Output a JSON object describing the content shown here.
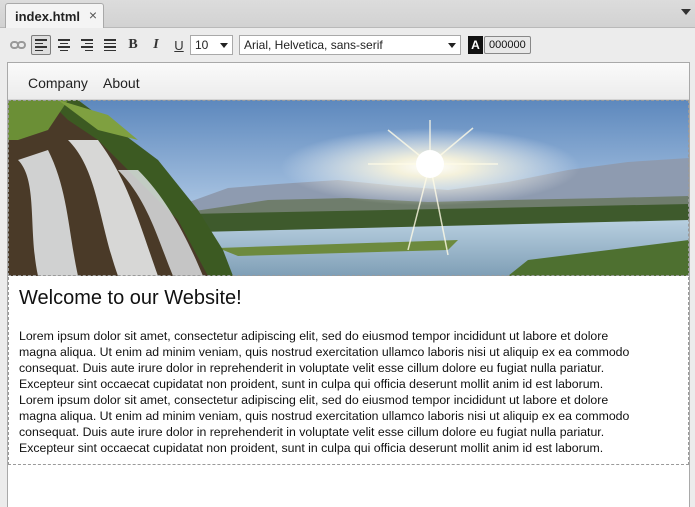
{
  "tab": {
    "title": "index.html",
    "close_symbol": "×"
  },
  "toolbar": {
    "bold": "B",
    "italic": "I",
    "underline": "U",
    "font_size": "10",
    "font_family": "Arial, Helvetica, sans-serif",
    "color_swatch": "A",
    "color_value": "000000"
  },
  "page": {
    "nav": {
      "items": [
        "Company",
        "About"
      ]
    },
    "hero": {
      "image_name": "waterfall-river-sunset"
    },
    "heading": "Welcome to our Website!",
    "paragraph_lines": [
      "Lorem ipsum dolor sit amet, consectetur adipiscing elit, sed do eiusmod tempor incididunt ut labore et dolore",
      "magna aliqua. Ut enim ad minim veniam, quis nostrud exercitation ullamco laboris nisi ut aliquip ex ea commodo",
      "consequat. Duis aute irure dolor in reprehenderit in voluptate velit esse cillum dolore eu fugiat nulla pariatur.",
      "Excepteur sint occaecat cupidatat non proident, sunt in culpa qui officia deserunt mollit anim id est laborum.",
      "Lorem ipsum dolor sit amet, consectetur adipiscing elit, sed do eiusmod tempor incididunt ut labore et dolore",
      "magna aliqua. Ut enim ad minim veniam, quis nostrud exercitation ullamco laboris nisi ut aliquip ex ea commodo",
      "consequat. Duis aute irure dolor in reprehenderit in voluptate velit esse cillum dolore eu fugiat nulla pariatur.",
      "Excepteur sint occaecat cupidatat non proident, sunt in culpa qui officia deserunt mollit anim id est laborum."
    ]
  },
  "colors": {
    "text_color": "#000000",
    "editor_bg": "#ffffff",
    "chrome_bg": "#ececec"
  }
}
